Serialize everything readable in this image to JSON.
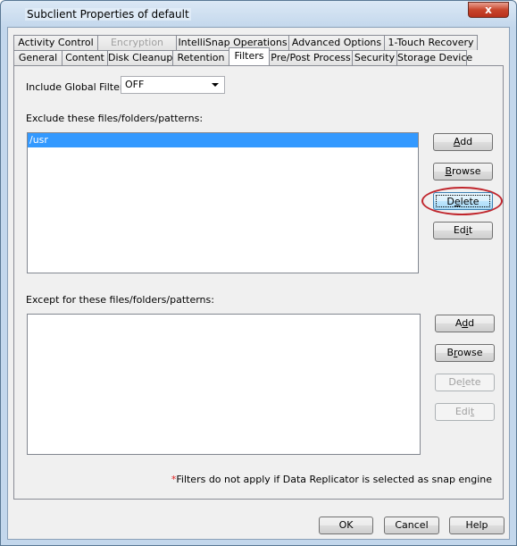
{
  "window": {
    "title": "Subclient Properties of default",
    "close_label": "x"
  },
  "tabs": {
    "row1": [
      {
        "label": "Activity Control",
        "disabled": false
      },
      {
        "label": "Encryption",
        "disabled": true
      },
      {
        "label": "IntelliSnap Operations",
        "disabled": false
      },
      {
        "label": "Advanced Options",
        "disabled": false
      },
      {
        "label": "1-Touch Recovery",
        "disabled": false
      }
    ],
    "row2": [
      {
        "label": "General"
      },
      {
        "label": "Content"
      },
      {
        "label": "Disk Cleanup"
      },
      {
        "label": "Retention"
      },
      {
        "label": "Filters",
        "active": true
      },
      {
        "label": "Pre/Post Process"
      },
      {
        "label": "Security"
      },
      {
        "label": "Storage Device"
      }
    ]
  },
  "filters": {
    "global_filters_label": "Include Global Filters",
    "global_filters_value": "OFF",
    "exclude_label": "Exclude these files/folders/patterns:",
    "exclude_items": [
      "/usr"
    ],
    "except_label": "Except for these files/folders/patterns:",
    "except_items": [],
    "exclude_buttons": {
      "add": "Add",
      "browse": "Browse",
      "delete": "Delete",
      "edit": "Edit"
    },
    "except_buttons": {
      "add": "Add",
      "browse": "Browse",
      "delete": "Delete",
      "edit": "Edit"
    },
    "note_asterisk": "*",
    "note": "Filters do not apply if Data Replicator is selected as snap engine"
  },
  "footer": {
    "ok": "OK",
    "cancel": "Cancel",
    "help": "Help"
  }
}
